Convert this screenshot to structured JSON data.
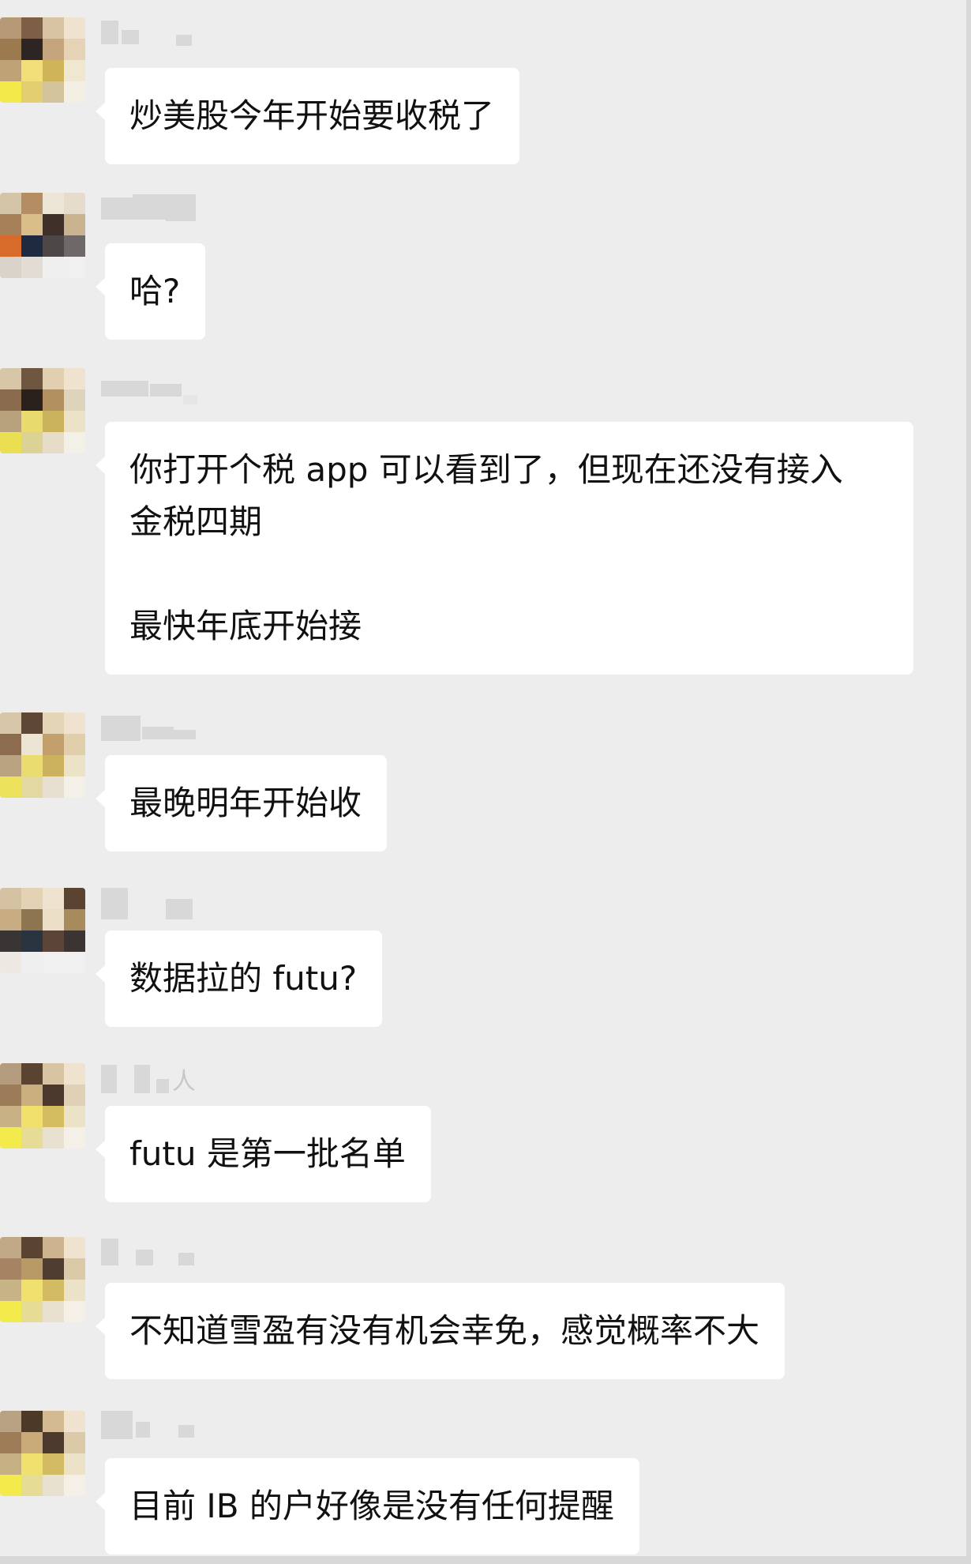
{
  "messages": [
    {
      "sender": "",
      "text": "炒美股今年开始要收税了"
    },
    {
      "sender": "",
      "text": "哈?"
    },
    {
      "sender": "",
      "text": "你打开个税 app 可以看到了，但现在还没有接入\n金税四期\n\n最快年底开始接"
    },
    {
      "sender": "",
      "text": "最晚明年开始收"
    },
    {
      "sender": "",
      "text": "数据拉的 futu?"
    },
    {
      "sender": "人",
      "text": "futu 是第一批名单"
    },
    {
      "sender": "",
      "text": "不知道雪盈有没有机会幸免，感觉概率不大"
    },
    {
      "sender": "",
      "text": "目前 IB 的户好像是没有任何提醒"
    }
  ],
  "colors": {
    "background": "#ededed",
    "bubble": "#ffffff",
    "text": "#111111",
    "blurred_name": "#d8d8d8"
  },
  "icons": {
    "avatar": "pixelated-avatar-icon"
  }
}
